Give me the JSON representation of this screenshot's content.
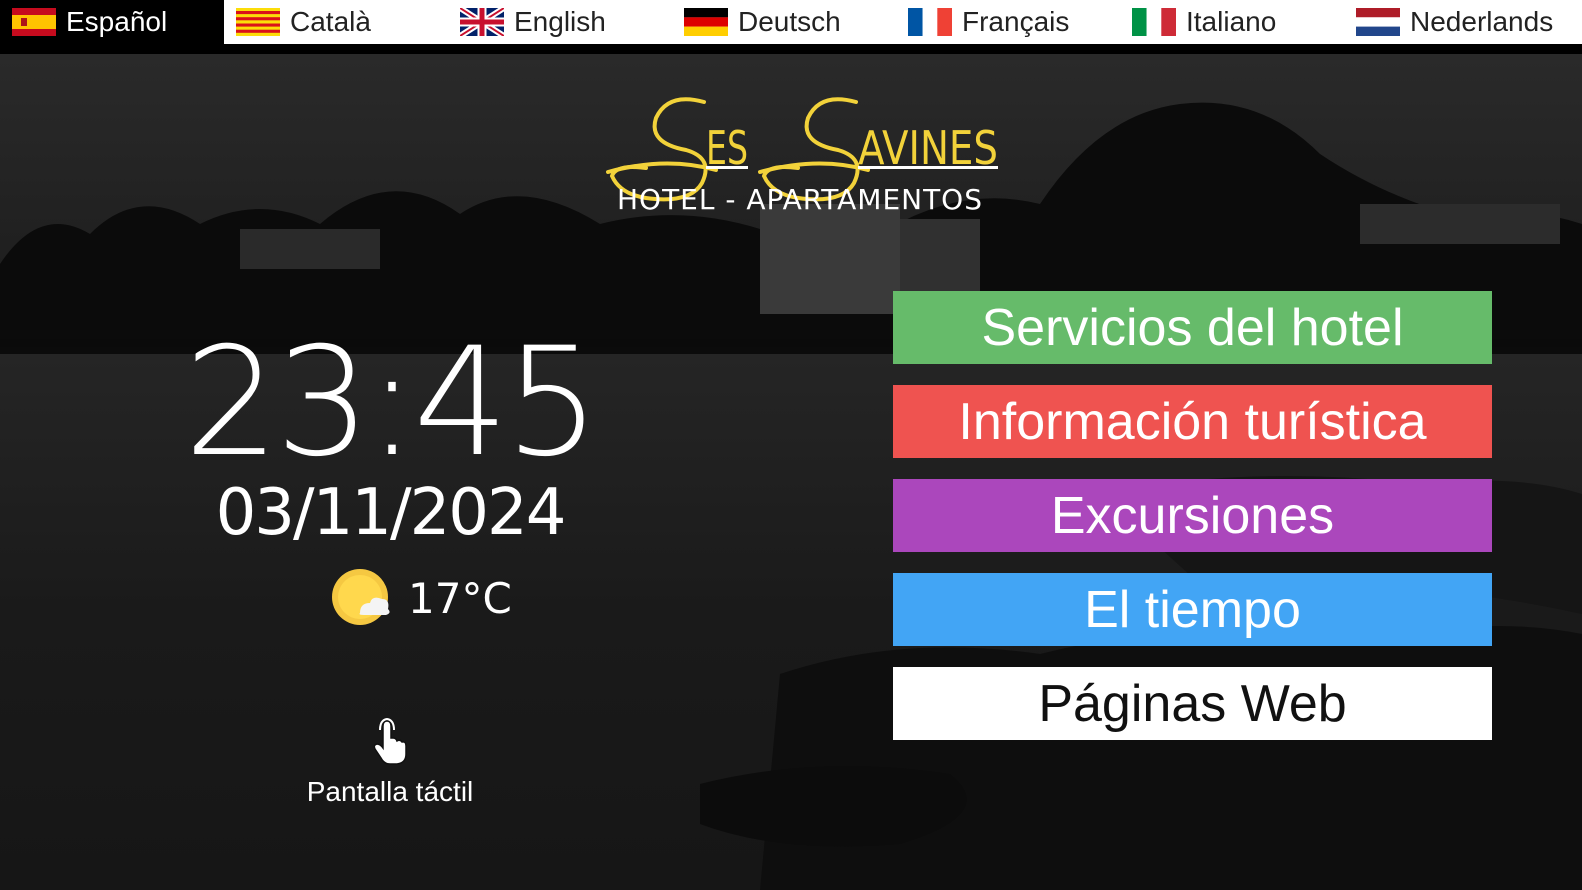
{
  "languages": [
    {
      "label": "Español",
      "flag": "spain-flag-icon",
      "active": true
    },
    {
      "label": "Català",
      "flag": "catalonia-flag-icon",
      "active": false
    },
    {
      "label": "English",
      "flag": "uk-flag-icon",
      "active": false
    },
    {
      "label": "Deutsch",
      "flag": "germany-flag-icon",
      "active": false
    },
    {
      "label": "Français",
      "flag": "france-flag-icon",
      "active": false
    },
    {
      "label": "Italiano",
      "flag": "italy-flag-icon",
      "active": false
    },
    {
      "label": "Nederlands",
      "flag": "netherlands-flag-icon",
      "active": false
    }
  ],
  "logo": {
    "name": "Ses Savines",
    "subtitle": "HOTEL - APARTAMENTOS",
    "color": "#f2d23a"
  },
  "clock": {
    "time": "23:45",
    "date": "03/11/2024"
  },
  "weather": {
    "icon": "sun-cloud-icon",
    "temperature": "17°C"
  },
  "touch": {
    "icon": "touch-hand-icon",
    "label": "Pantalla táctil"
  },
  "menu": [
    {
      "label": "Servicios del hotel",
      "color": "#66bb6a",
      "text_color": "#ffffff"
    },
    {
      "label": "Información turística",
      "color": "#ef5350",
      "text_color": "#ffffff"
    },
    {
      "label": "Excursiones",
      "color": "#ab47bc",
      "text_color": "#ffffff"
    },
    {
      "label": "El tiempo",
      "color": "#42a5f5",
      "text_color": "#ffffff"
    },
    {
      "label": "Páginas Web",
      "color": "#ffffff",
      "text_color": "#111111"
    }
  ]
}
